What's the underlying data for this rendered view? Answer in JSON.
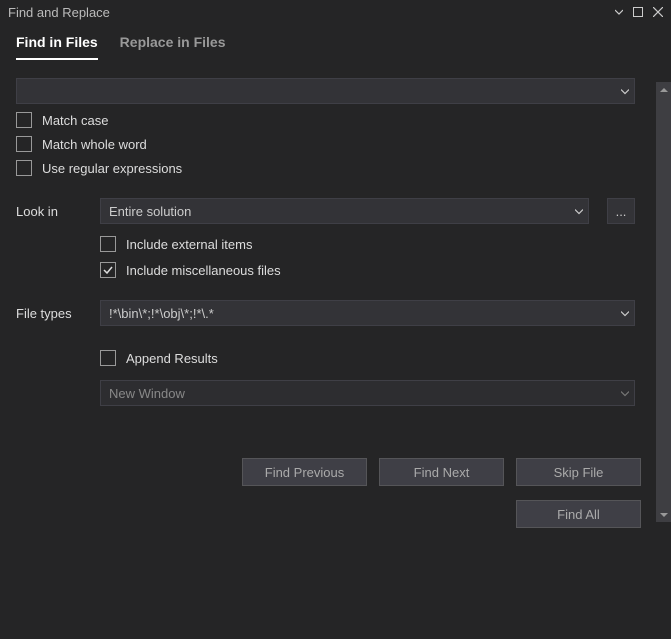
{
  "title": "Find and Replace",
  "tabs": {
    "find": "Find in Files",
    "replace": "Replace in Files"
  },
  "searchValue": "",
  "options": {
    "matchCase": "Match case",
    "matchWord": "Match whole word",
    "regex": "Use regular expressions"
  },
  "lookIn": {
    "label": "Look in",
    "value": "Entire solution",
    "browse": "..."
  },
  "lookInOptions": {
    "external": "Include external items",
    "misc": "Include miscellaneous files"
  },
  "fileTypes": {
    "label": "File types",
    "value": "!*\\bin\\*;!*\\obj\\*;!*\\.*"
  },
  "results": {
    "append": "Append Results",
    "window": "New Window"
  },
  "buttons": {
    "findPrev": "Find Previous",
    "findNext": "Find Next",
    "skip": "Skip File",
    "findAll": "Find All"
  }
}
